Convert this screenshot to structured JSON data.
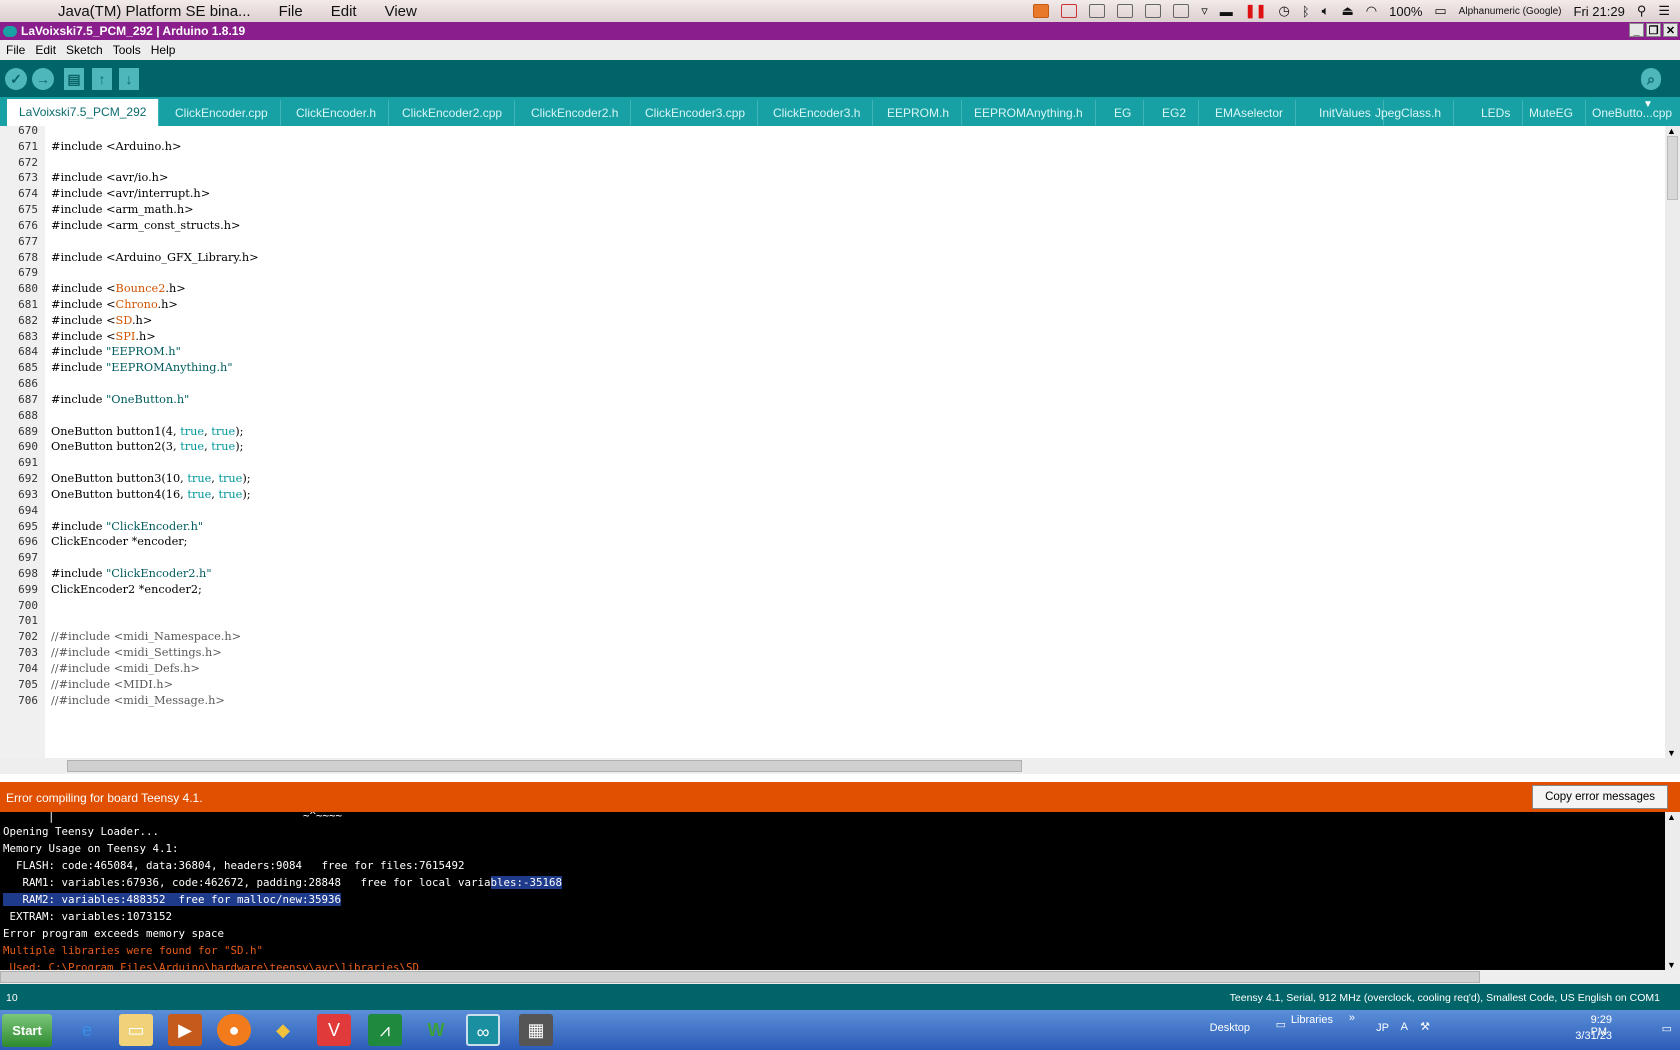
{
  "mac_menu": {
    "app": "Java(TM) Platform SE bina...",
    "file": "File",
    "edit": "Edit",
    "view": "View",
    "battery": "100%",
    "input": "Alphanumeric (Google)",
    "clock": "Fri 21:29"
  },
  "window": {
    "title": "LaVoixski7.5_PCM_292 | Arduino 1.8.19"
  },
  "menu": [
    "File",
    "Edit",
    "Sketch",
    "Tools",
    "Help"
  ],
  "tabs": [
    "LaVoixski7.5_PCM_292",
    "ClickEncoder.cpp",
    "ClickEncoder.h",
    "ClickEncoder2.cpp",
    "ClickEncoder2.h",
    "ClickEncoder3.cpp",
    "ClickEncoder3.h",
    "EEPROM.h",
    "EEPROMAnything.h",
    "EG",
    "EG2",
    "EMAselector",
    "InitValues",
    "JpegClass.h",
    "LEDs",
    "MuteEG",
    "OneButto...cpp"
  ],
  "lines": [
    "670",
    "671",
    "672",
    "673",
    "674",
    "675",
    "676",
    "677",
    "678",
    "679",
    "680",
    "681",
    "682",
    "683",
    "684",
    "685",
    "686",
    "687",
    "688",
    "689",
    "690",
    "691",
    "692",
    "693",
    "694",
    "695",
    "696",
    "697",
    "698",
    "699",
    "700",
    "701",
    "702",
    "703",
    "704",
    "705",
    "706"
  ],
  "code": {
    "l671": "#include <Arduino.h>",
    "l673": "#include <avr/io.h>",
    "l674": "#include <avr/interrupt.h>",
    "l675": "#include <arm_math.h>",
    "l676": "#include <arm_const_structs.h>",
    "l678": "#include <Arduino_GFX_Library.h>",
    "l680a": "#include <",
    "l680b": "Bounce2",
    "l680c": ".h>",
    "l681a": "#include <",
    "l681b": "Chrono",
    "l681c": ".h>",
    "l682a": "#include <",
    "l682b": "SD",
    "l682c": ".h>",
    "l683a": "#include <",
    "l683b": "SPI",
    "l683c": ".h>",
    "l684a": "#include ",
    "l684b": "\"EEPROM.h\"",
    "l685a": "#include ",
    "l685b": "\"EEPROMAnything.h\"",
    "l687a": "#include ",
    "l687b": "\"OneButton.h\"",
    "l689a": "OneButton button1(4, ",
    "l689b": "true",
    ", ": ", ",
    "l689c": "true",
    "l689d": ");",
    "l690a": "OneButton button2(3, ",
    "l692a": "OneButton button3(10, ",
    "l693a": "OneButton button4(16, ",
    "l695a": "#include ",
    "l695b": "\"ClickEncoder.h\"",
    "l696": "ClickEncoder *encoder;",
    "l698a": "#include ",
    "l698b": "\"ClickEncoder2.h\"",
    "l699": "ClickEncoder2 *encoder2;",
    "l702": "//#include <midi_Namespace.h>",
    "l703": "//#include <midi_Settings.h>",
    "l704": "//#include <midi_Defs.h>",
    "l705": "//#include <MIDI.h>",
    "l706": "//#include <midi_Message.h>",
    "true": "true",
    "comma": ", ",
    "close": ");"
  },
  "error": {
    "message": "Error compiling for board Teensy 4.1.",
    "copy_button": "Copy error messages"
  },
  "console": {
    "c0": "~^~~~~",
    "c1": "Opening Teensy Loader...",
    "c2": "Memory Usage on Teensy 4.1:",
    "c3": "  FLASH: code:465084, data:36804, headers:9084   free for files:7615492",
    "c4a": "   RAM1: variables:67936, code:462672, padding:28848   free for local varia",
    "c4b": "bles:-35168",
    "c5": "   RAM2: variables:488352  free for malloc/new:35936",
    "c6": " EXTRAM: variables:1073152",
    "c7": "Error program exceeds memory space",
    "c8": "Multiple libraries were found for \"SD.h\"",
    "c9": " Used: C:\\Program Files\\Arduino\\hardware\\teensy\\avr\\libraries\\SD"
  },
  "status": {
    "line": "10",
    "board": "Teensy 4.1, Serial, 912 MHz (overclock, cooling req'd), Smallest Code, US English on COM1"
  },
  "taskbar": {
    "start": "Start",
    "desktop": "Desktop",
    "libraries": "Libraries",
    "lang": "JP",
    "time": "9:29 PM",
    "date": "3/31/23"
  }
}
